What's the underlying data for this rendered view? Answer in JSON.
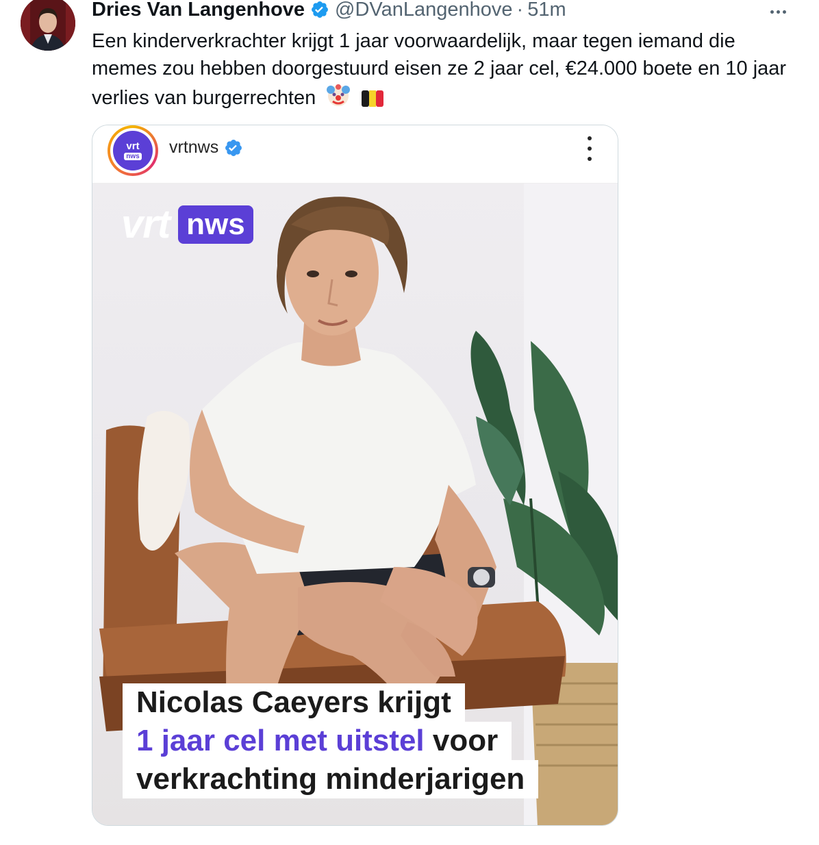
{
  "author": {
    "name": "Dries Van Langenhove",
    "handle": "@DVanLangenhove",
    "separator": "·",
    "time": "51m",
    "verified": true
  },
  "tweet": {
    "text": "Een kinderverkrachter krijgt 1 jaar voorwaardelijk, maar tegen iemand die memes zou hebben doorgestuurd eisen ze 2 jaar cel, €24.000 boete en 10 jaar verlies van burgerrechten",
    "emojis": [
      "clown-face-emoji",
      "belgian-flag-emoji"
    ]
  },
  "media": {
    "account": {
      "username": "vrtnws",
      "avatar_top": "vrt",
      "avatar_bottom": "nws",
      "verified": true
    },
    "logo": {
      "part1": "vrt",
      "part2": "nws"
    },
    "caption": {
      "line1": "Nicolas Caeyers krijgt",
      "line2_accent": "1 jaar cel met uitstel",
      "line2_rest": " voor",
      "line3": "verkrachting minderjarigen"
    }
  },
  "colors": {
    "brand_purple": "#5b3fd6",
    "verified_blue": "#1d9bf0",
    "text_primary": "#0f1419",
    "text_secondary": "#536471"
  }
}
